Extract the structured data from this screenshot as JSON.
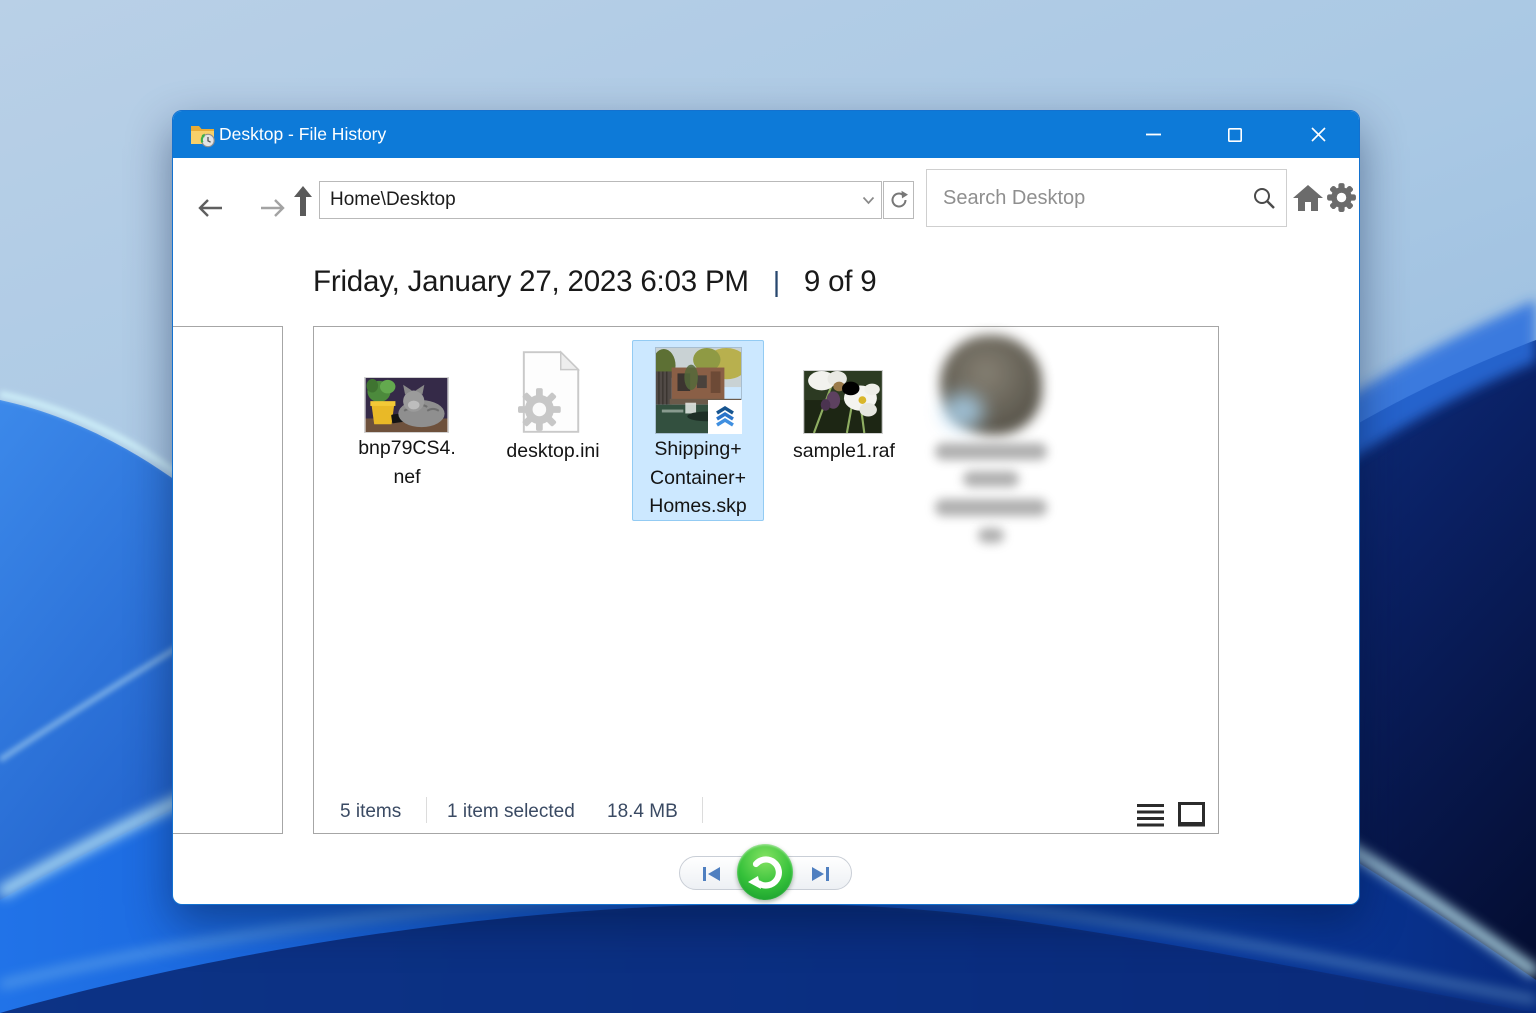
{
  "window": {
    "title": "Desktop - File History"
  },
  "toolbar": {
    "address_value": "Home\\Desktop",
    "search_placeholder": "Search Desktop"
  },
  "heading": {
    "date": "Friday, January 27, 2023 6:03 PM",
    "separator": "|",
    "position": "9 of 9"
  },
  "files": [
    {
      "kind": "raw-image-cat-photo",
      "label_lines": [
        "bnp79CS4.",
        "nef"
      ],
      "selected": false
    },
    {
      "kind": "system-settings-file",
      "label_lines": [
        "desktop.ini"
      ],
      "selected": false
    },
    {
      "kind": "sketchup-model-thumbnail",
      "label_lines": [
        "Shipping+",
        "Container+",
        "Homes.skp"
      ],
      "selected": true
    },
    {
      "kind": "raw-image-flowers-photo",
      "label_lines": [
        "sample1.raf"
      ],
      "selected": false
    },
    {
      "kind": "redacted-blurred-item",
      "label_lines": [],
      "selected": false
    }
  ],
  "status_bar": {
    "item_count": "5 items",
    "selection": "1 item selected",
    "selection_size": "18.4 MB"
  },
  "icons": {
    "titlebar": "folder-with-history-clock",
    "nav": [
      "back-arrow",
      "forward-arrow",
      "up-arrow"
    ],
    "address": [
      "dropdown-chevron",
      "refresh"
    ],
    "search": "magnifier",
    "right_tools": [
      "home",
      "settings-gear"
    ],
    "view_toggles": [
      "list-view",
      "thumbnail-view"
    ],
    "bottom_nav": [
      "previous-version",
      "restore-green-arrow",
      "next-version"
    ]
  },
  "colors": {
    "titlebar": "#0d7ad8",
    "selection_fill": "#cce8ff",
    "selection_border": "#93cbf3",
    "restore_green": "#35c13a",
    "nav_icon_blue": "#4f7fc0",
    "status_text": "#3a4a63"
  }
}
